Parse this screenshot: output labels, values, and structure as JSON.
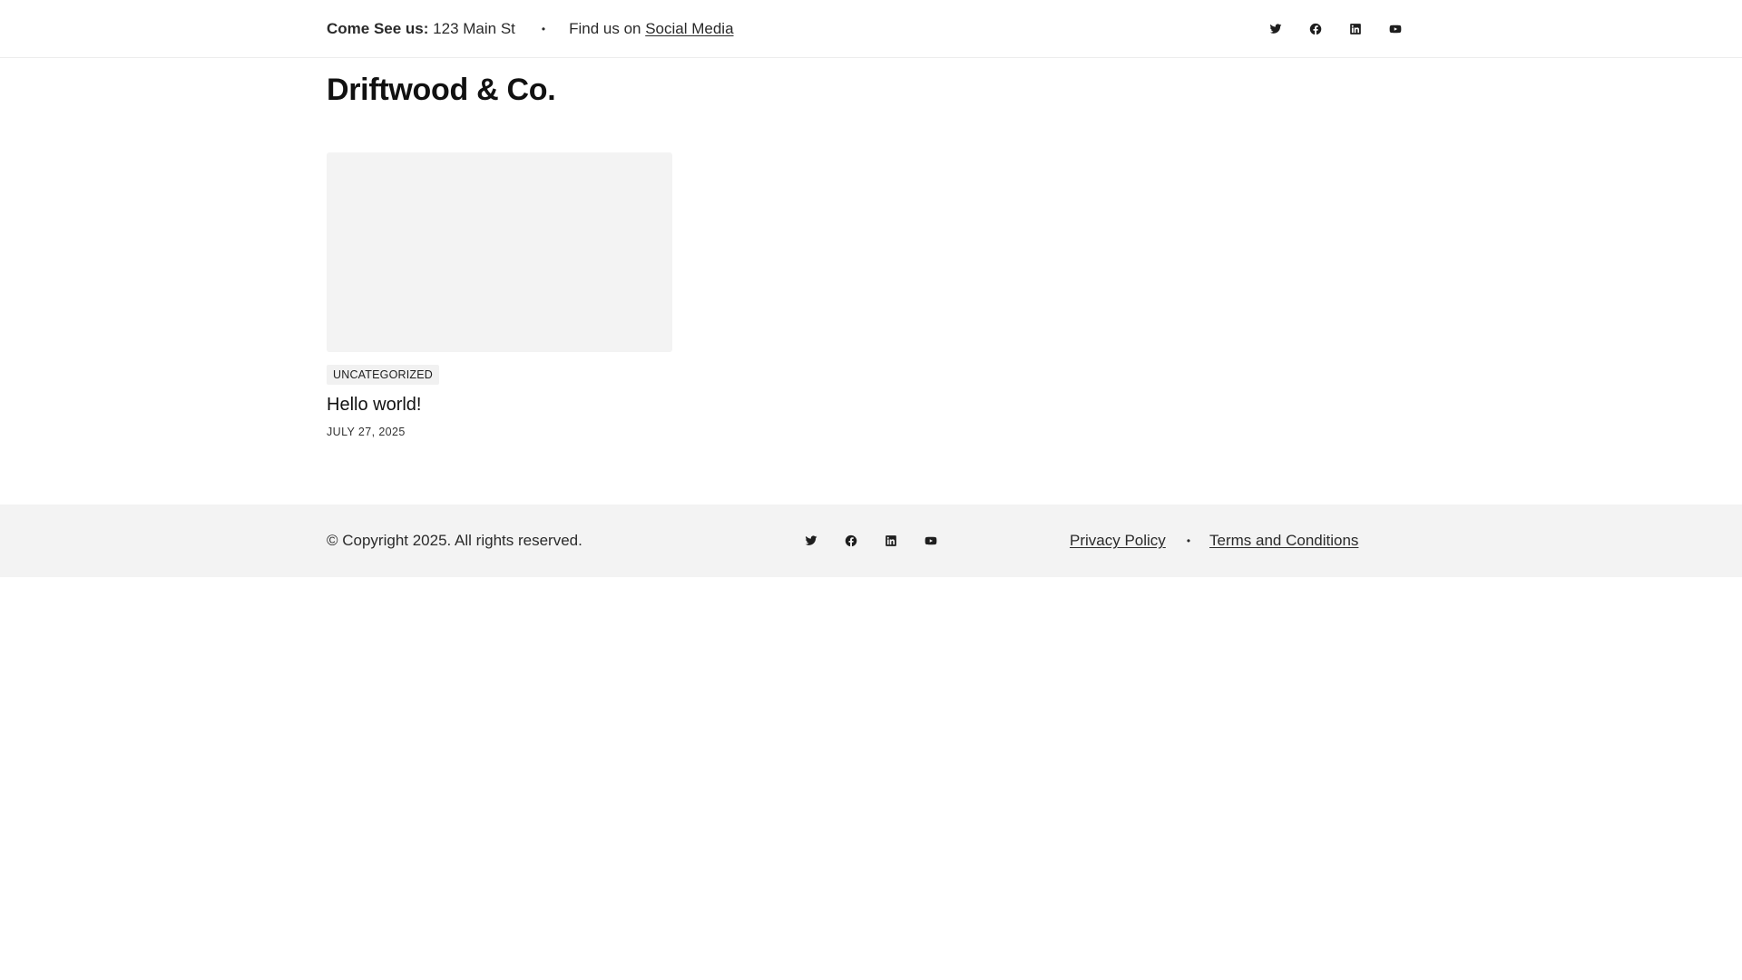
{
  "topbar": {
    "address_label": "Come See us:",
    "address_value": " 123 Main St",
    "separator": "•",
    "find_prefix": "Find us on ",
    "find_link": "Social Media"
  },
  "social_icons": [
    "twitter-icon",
    "facebook-icon",
    "linkedin-icon",
    "youtube-icon"
  ],
  "site": {
    "title": "Driftwood & Co."
  },
  "post": {
    "category": "UNCATEGORIZED",
    "title": "Hello world!",
    "date": "JULY 27, 2025"
  },
  "footer": {
    "copyright": "© Copyright 2025. All rights reserved.",
    "privacy": "Privacy Policy",
    "separator": "•",
    "terms": "Terms and Conditions"
  },
  "colors": {
    "text": "#1e1e1e",
    "footer_bg": "#f3f3f3",
    "thumb_bg": "#f3f3f3",
    "divider": "#ececec"
  }
}
